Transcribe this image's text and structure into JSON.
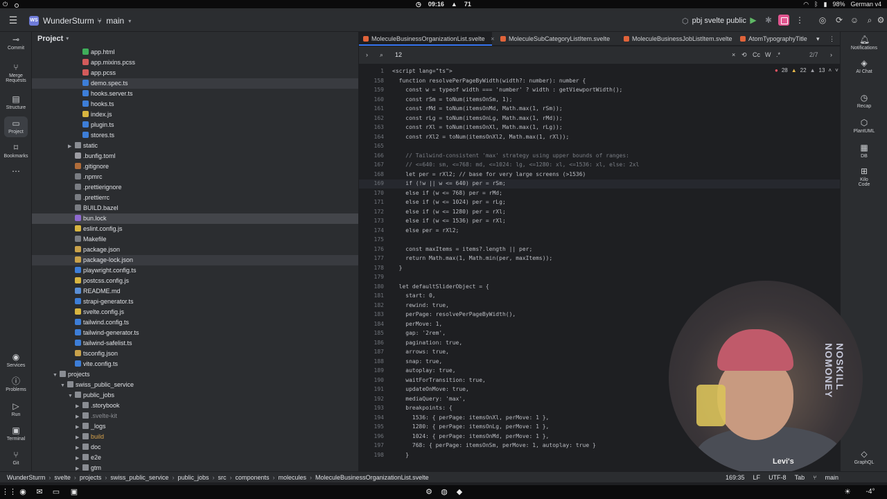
{
  "os": {
    "time": "09:16",
    "temp_label": "71",
    "battery": "98%",
    "keyboard": "German v4"
  },
  "toolbar": {
    "project_badge": "WS",
    "project_name": "WunderSturm",
    "branch": "main",
    "run_config": "pbj svelte public"
  },
  "left_strip": [
    "Commit",
    "Merge Requests",
    "Structure",
    "Project",
    "Bookmarks",
    "Services",
    "Problems",
    "Run",
    "Terminal",
    "Git"
  ],
  "right_strip": [
    "Notifications",
    "AI Chat",
    "Recap",
    "PlantUML",
    "DB",
    "Kilo Code",
    "GraphQL"
  ],
  "project": {
    "title": "Project",
    "rows": [
      {
        "name": "app.html",
        "icon": "html",
        "indent": 5,
        "state": ""
      },
      {
        "name": "app.mixins.pcss",
        "icon": "pcss",
        "indent": 5,
        "state": ""
      },
      {
        "name": "app.pcss",
        "icon": "pcss",
        "indent": 5,
        "state": ""
      },
      {
        "name": "demo.spec.ts",
        "icon": "ts",
        "indent": 5,
        "state": "sel2"
      },
      {
        "name": "hooks.server.ts",
        "icon": "ts",
        "indent": 5,
        "state": ""
      },
      {
        "name": "hooks.ts",
        "icon": "ts",
        "indent": 5,
        "state": ""
      },
      {
        "name": "index.js",
        "icon": "js",
        "indent": 5,
        "state": ""
      },
      {
        "name": "plugin.ts",
        "icon": "ts",
        "indent": 5,
        "state": ""
      },
      {
        "name": "stores.ts",
        "icon": "ts",
        "indent": 5,
        "state": ""
      },
      {
        "name": "static",
        "icon": "folder",
        "indent": 4,
        "state": "",
        "arrow": "▶"
      },
      {
        "name": ".bunfig.toml",
        "icon": "toml",
        "indent": 4,
        "state": ""
      },
      {
        "name": ".gitignore",
        "icon": "excl",
        "indent": 4,
        "state": ""
      },
      {
        "name": ".npmrc",
        "icon": "cfg",
        "indent": 4,
        "state": ""
      },
      {
        "name": ".prettierignore",
        "icon": "cfg",
        "indent": 4,
        "state": ""
      },
      {
        "name": ".prettierrc",
        "icon": "cfg",
        "indent": 4,
        "state": ""
      },
      {
        "name": "BUILD.bazel",
        "icon": "cfg",
        "indent": 4,
        "state": ""
      },
      {
        "name": "bun.lock",
        "icon": "lock",
        "indent": 4,
        "state": "sel"
      },
      {
        "name": "eslint.config.js",
        "icon": "js",
        "indent": 4,
        "state": ""
      },
      {
        "name": "Makefile",
        "icon": "cfg",
        "indent": 4,
        "state": ""
      },
      {
        "name": "package.json",
        "icon": "json",
        "indent": 4,
        "state": ""
      },
      {
        "name": "package-lock.json",
        "icon": "json",
        "indent": 4,
        "state": "sel2"
      },
      {
        "name": "playwright.config.ts",
        "icon": "ts",
        "indent": 4,
        "state": ""
      },
      {
        "name": "postcss.config.js",
        "icon": "js",
        "indent": 4,
        "state": ""
      },
      {
        "name": "README.md",
        "icon": "md",
        "indent": 4,
        "state": ""
      },
      {
        "name": "strapi-generator.ts",
        "icon": "ts",
        "indent": 4,
        "state": ""
      },
      {
        "name": "svelte.config.js",
        "icon": "js",
        "indent": 4,
        "state": ""
      },
      {
        "name": "tailwind.config.ts",
        "icon": "ts",
        "indent": 4,
        "state": ""
      },
      {
        "name": "tailwind-generator.ts",
        "icon": "ts",
        "indent": 4,
        "state": ""
      },
      {
        "name": "tailwind-safelist.ts",
        "icon": "ts",
        "indent": 4,
        "state": ""
      },
      {
        "name": "tsconfig.json",
        "icon": "json",
        "indent": 4,
        "state": ""
      },
      {
        "name": "vite.config.ts",
        "icon": "ts",
        "indent": 4,
        "state": ""
      },
      {
        "name": "projects",
        "icon": "folder",
        "indent": 2,
        "state": "",
        "arrow": "▼"
      },
      {
        "name": "swiss_public_service",
        "icon": "folder",
        "indent": 3,
        "state": "",
        "arrow": "▼"
      },
      {
        "name": "public_jobs",
        "icon": "folder",
        "indent": 4,
        "state": "",
        "arrow": "▼"
      },
      {
        "name": ".storybook",
        "icon": "folder",
        "indent": 5,
        "state": "",
        "arrow": "▶"
      },
      {
        "name": ".svelte-kit",
        "icon": "folder",
        "indent": 5,
        "state": "dim",
        "arrow": "▶"
      },
      {
        "name": "_logs",
        "icon": "folder",
        "indent": 5,
        "state": "",
        "arrow": "▶"
      },
      {
        "name": "build",
        "icon": "folder",
        "indent": 5,
        "state": "orange",
        "arrow": "▶"
      },
      {
        "name": "doc",
        "icon": "folder",
        "indent": 5,
        "state": "",
        "arrow": "▶"
      },
      {
        "name": "e2e",
        "icon": "folder",
        "indent": 5,
        "state": "",
        "arrow": "▶"
      },
      {
        "name": "gtm",
        "icon": "folder",
        "indent": 5,
        "state": "",
        "arrow": "▶"
      }
    ]
  },
  "editor": {
    "tabs": [
      {
        "label": "MoleculeBusinessOrganizationList.svelte",
        "active": true
      },
      {
        "label": "MoleculeSubCategoryListItem.svelte",
        "active": false
      },
      {
        "label": "MoleculeBusinessJobListItem.svelte",
        "active": false
      },
      {
        "label": "AtomTypographyTitle",
        "active": false
      }
    ],
    "find": {
      "query": "12",
      "match_case": "Cc",
      "words": "W",
      "regex": ".*",
      "count": "2/7"
    },
    "inspections": {
      "errors": "28",
      "warnings": "22",
      "weak": "13"
    },
    "lines": [
      {
        "n": "1",
        "t": "<script lang=\"ts\">"
      },
      {
        "n": "158",
        "t": "  function resolvePerPageByWidth(width?: number): number {"
      },
      {
        "n": "159",
        "t": "    const w = typeof width === 'number' ? width : getViewportWidth();"
      },
      {
        "n": "160",
        "t": "    const rSm = toNum(itemsOnSm, 1);"
      },
      {
        "n": "161",
        "t": "    const rMd = toNum(itemsOnMd, Math.max(1, rSm));"
      },
      {
        "n": "162",
        "t": "    const rLg = toNum(itemsOnLg, Math.max(1, rMd));"
      },
      {
        "n": "163",
        "t": "    const rXl = toNum(itemsOnXl, Math.max(1, rLg));"
      },
      {
        "n": "164",
        "t": "    const rXl2 = toNum(itemsOnXl2, Math.max(1, rXl));"
      },
      {
        "n": "165",
        "t": ""
      },
      {
        "n": "166",
        "t": "    // Tailwind-consistent 'max' strategy using upper bounds of ranges:"
      },
      {
        "n": "167",
        "t": "    // <=640: sm, <=768: md, <=1024: lg, <=1280: xl, <=1536: xl, else: 2xl"
      },
      {
        "n": "168",
        "t": "    let per = rXl2; // base for very large screens (>1536)"
      },
      {
        "n": "169",
        "t": "    if (!w || w <= 640) per = rSm;"
      },
      {
        "n": "170",
        "t": "    else if (w <= 768) per = rMd;"
      },
      {
        "n": "171",
        "t": "    else if (w <= 1024) per = rLg;"
      },
      {
        "n": "172",
        "t": "    else if (w <= 1280) per = rXl;"
      },
      {
        "n": "173",
        "t": "    else if (w <= 1536) per = rXl;"
      },
      {
        "n": "174",
        "t": "    else per = rXl2;"
      },
      {
        "n": "175",
        "t": ""
      },
      {
        "n": "176",
        "t": "    const maxItems = items?.length || per;"
      },
      {
        "n": "177",
        "t": "    return Math.max(1, Math.min(per, maxItems));"
      },
      {
        "n": "178",
        "t": "  }"
      },
      {
        "n": "179",
        "t": ""
      },
      {
        "n": "180",
        "t": "  let defaultSliderObject = {"
      },
      {
        "n": "181",
        "t": "    start: 0,"
      },
      {
        "n": "182",
        "t": "    rewind: true,"
      },
      {
        "n": "183",
        "t": "    perPage: resolvePerPageByWidth(),"
      },
      {
        "n": "184",
        "t": "    perMove: 1,"
      },
      {
        "n": "185",
        "t": "    gap: '2rem',"
      },
      {
        "n": "186",
        "t": "    pagination: true,"
      },
      {
        "n": "187",
        "t": "    arrows: true,"
      },
      {
        "n": "188",
        "t": "    snap: true,"
      },
      {
        "n": "189",
        "t": "    autoplay: true,"
      },
      {
        "n": "190",
        "t": "    waitForTransition: true,"
      },
      {
        "n": "191",
        "t": "    updateOnMove: true,"
      },
      {
        "n": "192",
        "t": "    mediaQuery: 'max',"
      },
      {
        "n": "193",
        "t": "    breakpoints: {"
      },
      {
        "n": "194",
        "t": "      1536: { perPage: itemsOnXl, perMove: 1 },"
      },
      {
        "n": "195",
        "t": "      1280: { perPage: itemsOnLg, perMove: 1 },"
      },
      {
        "n": "196",
        "t": "      1024: { perPage: itemsOnMd, perMove: 1 },"
      },
      {
        "n": "197",
        "t": "      768: { perPage: itemsOnSm, perMove: 1, autoplay: true }"
      },
      {
        "n": "198",
        "t": "    }"
      }
    ]
  },
  "status": {
    "breadcrumbs": [
      "WunderSturm",
      "svelte",
      "projects",
      "swiss_public_service",
      "public_jobs",
      "src",
      "components",
      "molecules",
      "MoleculeBusinessOrganizationList.svelte"
    ],
    "position": "169:35",
    "line_sep": "LF",
    "encoding": "UTF-8",
    "indent": "Tab",
    "branch": "main"
  },
  "taskbar": {
    "weather": "-4°"
  },
  "webcam": {
    "shirt_text": "NOSKILL NOMONEY",
    "tag": "Levi's"
  },
  "colors": {
    "accent": "#3574f0",
    "stop": "#e0558f",
    "svelte": "#e0633a"
  }
}
